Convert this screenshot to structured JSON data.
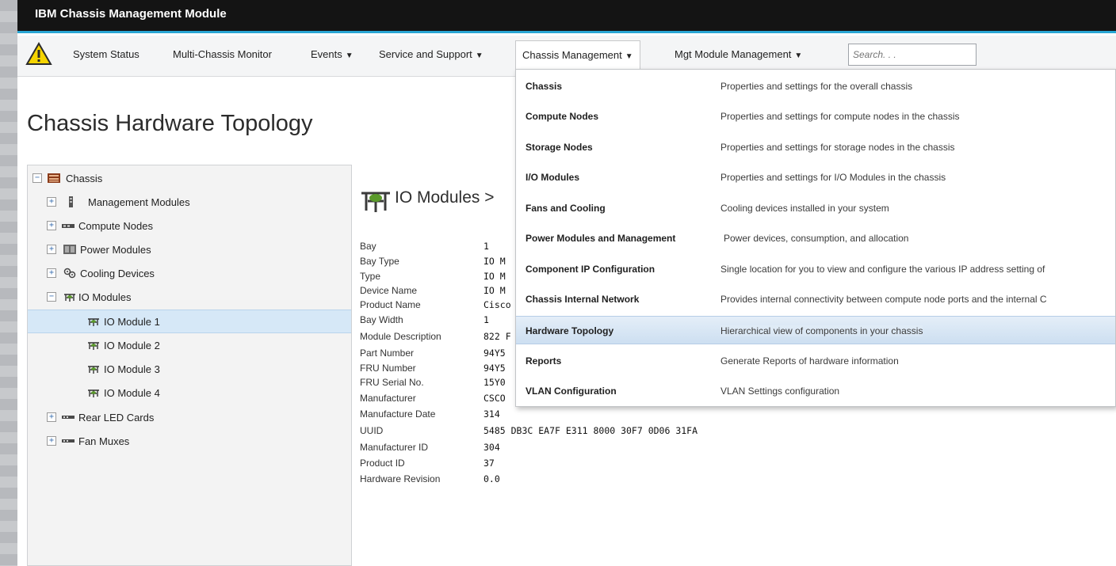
{
  "app": {
    "title": "IBM Chassis Management Module"
  },
  "menubar": {
    "items": [
      {
        "label": "System Status",
        "caret": false
      },
      {
        "label": "Multi-Chassis Monitor",
        "caret": false
      },
      {
        "label": "Events",
        "caret": true
      },
      {
        "label": "Service and Support",
        "caret": true
      },
      {
        "label": "Chassis Management",
        "caret": true
      },
      {
        "label": "Mgt Module Management",
        "caret": true
      }
    ],
    "search_placeholder": "Search. . ."
  },
  "page": {
    "title": "Chassis Hardware Topology"
  },
  "tree": {
    "items": [
      {
        "label": "Chassis",
        "toggle": "−",
        "icon": "chassis-icon"
      },
      {
        "label": "Management Modules",
        "toggle": "+",
        "icon": "management-module-icon"
      },
      {
        "label": "Compute Nodes",
        "toggle": "+",
        "icon": "compute-node-icon"
      },
      {
        "label": "Power Modules",
        "toggle": "+",
        "icon": "power-module-icon"
      },
      {
        "label": "Cooling Devices",
        "toggle": "+",
        "icon": "cooling-icon"
      },
      {
        "label": "IO Modules",
        "toggle": "−",
        "icon": "io-module-icon"
      },
      {
        "label": "IO Module 1",
        "toggle": "",
        "icon": "io-module-icon"
      },
      {
        "label": "IO Module 2",
        "toggle": "",
        "icon": "io-module-icon"
      },
      {
        "label": "IO Module 3",
        "toggle": "",
        "icon": "io-module-icon"
      },
      {
        "label": "IO Module 4",
        "toggle": "",
        "icon": "io-module-icon"
      },
      {
        "label": "Rear LED Cards",
        "toggle": "+",
        "icon": "led-card-icon"
      },
      {
        "label": "Fan Muxes",
        "toggle": "+",
        "icon": "fan-mux-icon"
      }
    ],
    "selected_index": 6
  },
  "detail": {
    "heading": "IO Modules >",
    "properties": [
      {
        "key": "Bay",
        "value": "1"
      },
      {
        "key": "Bay Type",
        "value": "IO M"
      },
      {
        "key": "Type",
        "value": "IO M"
      },
      {
        "key": "Device Name",
        "value": "IO M"
      },
      {
        "key": "Product Name",
        "value": "Cisco"
      },
      {
        "key": "Bay Width",
        "value": "1"
      },
      {
        "key": "Module Description",
        "value": "822 F"
      },
      {
        "key": "Part Number",
        "value": "94Y5"
      },
      {
        "key": "FRU Number",
        "value": "94Y5"
      },
      {
        "key": "FRU Serial No.",
        "value": "15Y0"
      },
      {
        "key": "Manufacturer",
        "value": "CSCO"
      },
      {
        "key": "Manufacture Date",
        "value": "314"
      },
      {
        "key": "UUID",
        "value": "5485 DB3C EA7F E311 8000 30F7 0D06 31FA"
      },
      {
        "key": "Manufacturer ID",
        "value": "304"
      },
      {
        "key": "Product ID",
        "value": "37"
      },
      {
        "key": "Hardware Revision",
        "value": "0.0"
      }
    ]
  },
  "dropdown": {
    "items": [
      {
        "label": "Chassis",
        "desc": "Properties and settings for the overall chassis"
      },
      {
        "label": "Compute Nodes",
        "desc": "Properties and settings for compute nodes in the chassis"
      },
      {
        "label": "Storage Nodes",
        "desc": "Properties and settings for storage nodes in the chassis"
      },
      {
        "label": "I/O Modules",
        "desc": "Properties and settings for I/O Modules in the chassis"
      },
      {
        "label": "Fans and Cooling",
        "desc": "Cooling devices installed in your system"
      },
      {
        "label": "Power Modules and Management",
        "desc": "Power devices, consumption, and allocation"
      },
      {
        "label": "Component IP Configuration",
        "desc": "Single location for you to view and configure the various IP address setting of"
      },
      {
        "label": "Chassis Internal Network",
        "desc": "Provides internal connectivity between compute node ports and the internal C"
      },
      {
        "label": "Hardware Topology",
        "desc": "Hierarchical view of components in your chassis"
      },
      {
        "label": "Reports",
        "desc": "Generate Reports of hardware information"
      },
      {
        "label": "VLAN Configuration",
        "desc": "VLAN Settings configuration"
      }
    ],
    "highlight_index": 8
  },
  "colors": {
    "titlebar_bg": "#141414",
    "accent_stripe": "#29a6d4",
    "selection_bg": "#d6e8f7",
    "warning_yellow": "#f5d400"
  }
}
